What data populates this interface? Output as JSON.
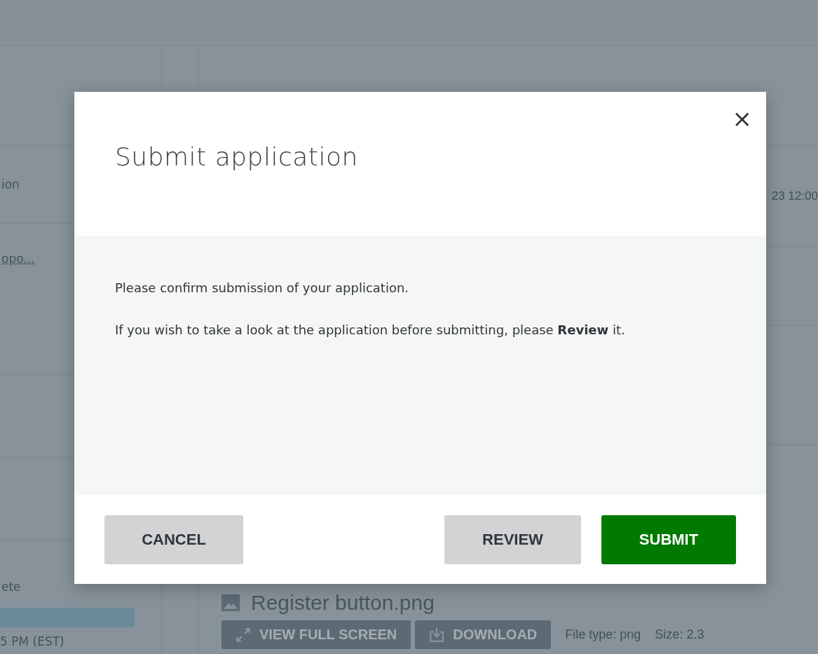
{
  "background": {
    "sidebar_rows": [
      {
        "text": "ion",
        "kind": "label"
      },
      {
        "text": "opo...",
        "kind": "link"
      },
      {
        "text": "",
        "kind": "blank"
      },
      {
        "text": "",
        "kind": "blank"
      },
      {
        "text": "ete",
        "kind": "label"
      }
    ],
    "sidebar_time": "5 PM (EST)",
    "date_text": "23 12:00",
    "file": {
      "name": "Register button.png",
      "buttons": [
        {
          "label": "VIEW FULL SCREEN",
          "kind": "expand"
        },
        {
          "label": "DOWNLOAD",
          "kind": "download"
        }
      ],
      "file_type": "File type: png",
      "size": "Size: 2.3"
    }
  },
  "dialog": {
    "title": "Submit application",
    "close": "×",
    "paragraphs": [
      "Please confirm submission of your application.",
      "If you wish to take a look at the application before submitting, please **Review** it."
    ],
    "buttons": [
      {
        "label": "CANCEL",
        "kind": "secondary"
      },
      {
        "label": "REVIEW",
        "kind": "secondary"
      },
      {
        "label": "SUBMIT",
        "kind": "primary"
      }
    ]
  }
}
